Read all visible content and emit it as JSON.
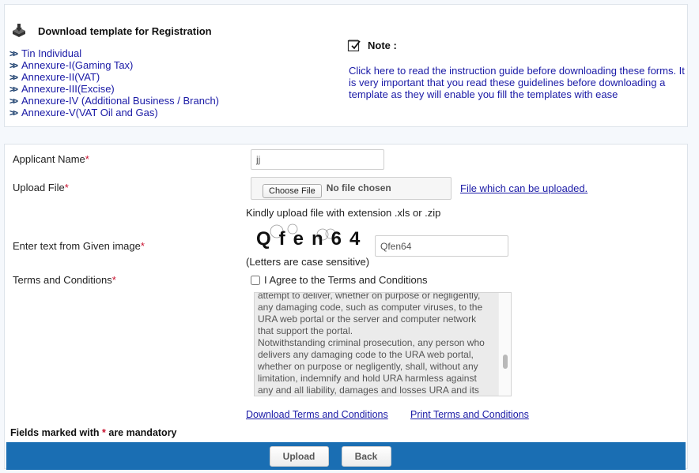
{
  "download": {
    "title": "Download template for Registration",
    "icon": "download-tray-icon",
    "links": [
      "Tin Individual",
      "Annexure-I(Gaming Tax)",
      "Annexure-II(VAT)",
      "Annexure-III(Excise)",
      "Annexure-IV (Additional Business / Branch)",
      "Annexure-V(VAT Oil and Gas)"
    ],
    "link_glyph": "»"
  },
  "note": {
    "title": "Note :",
    "icon": "notepad-check-icon",
    "text": "Click here to read the instruction guide before downloading these forms. It is very important that you read these guidelines before downloading a template as they will enable you fill the templates with ease"
  },
  "form": {
    "required_mark": "*",
    "applicant_name": {
      "label": "Applicant Name",
      "value": "jj"
    },
    "upload_file": {
      "label": "Upload File",
      "button_label": "Choose File",
      "status": "No file chosen",
      "link": "File which can be uploaded.",
      "hint": "Kindly upload file with extension .xls or .zip"
    },
    "captcha": {
      "label": "Enter text from Given image",
      "image_text": "Qfen64",
      "value": "Qfen64",
      "hint": "(Letters are case sensitive)"
    },
    "terms": {
      "label": "Terms and Conditions",
      "agree_label": "I Agree to the Terms and Conditions",
      "agree_checked": false,
      "text": "attempt to deliver, whether on purpose or negligently, any damaging code, such as computer viruses, to the URA web portal or the server and computer network that support the portal.\nNotwithstanding criminal prosecution, any person who delivers any damaging code to the URA web portal, whether on purpose or negligently, shall, without any limitation, indemnify and hold URA harmless against any and all liability, damages and losses URA and its",
      "download_link": "Download Terms and Conditions",
      "print_link": "Print Terms and Conditions"
    },
    "mandatory_note_prefix": "Fields marked with ",
    "mandatory_note_suffix": " are mandatory"
  },
  "actions": {
    "upload_label": "Upload",
    "back_label": "Back"
  },
  "colors": {
    "link": "#1a1aa6",
    "required": "#c8102e",
    "action_bar": "#1a6eb3"
  }
}
